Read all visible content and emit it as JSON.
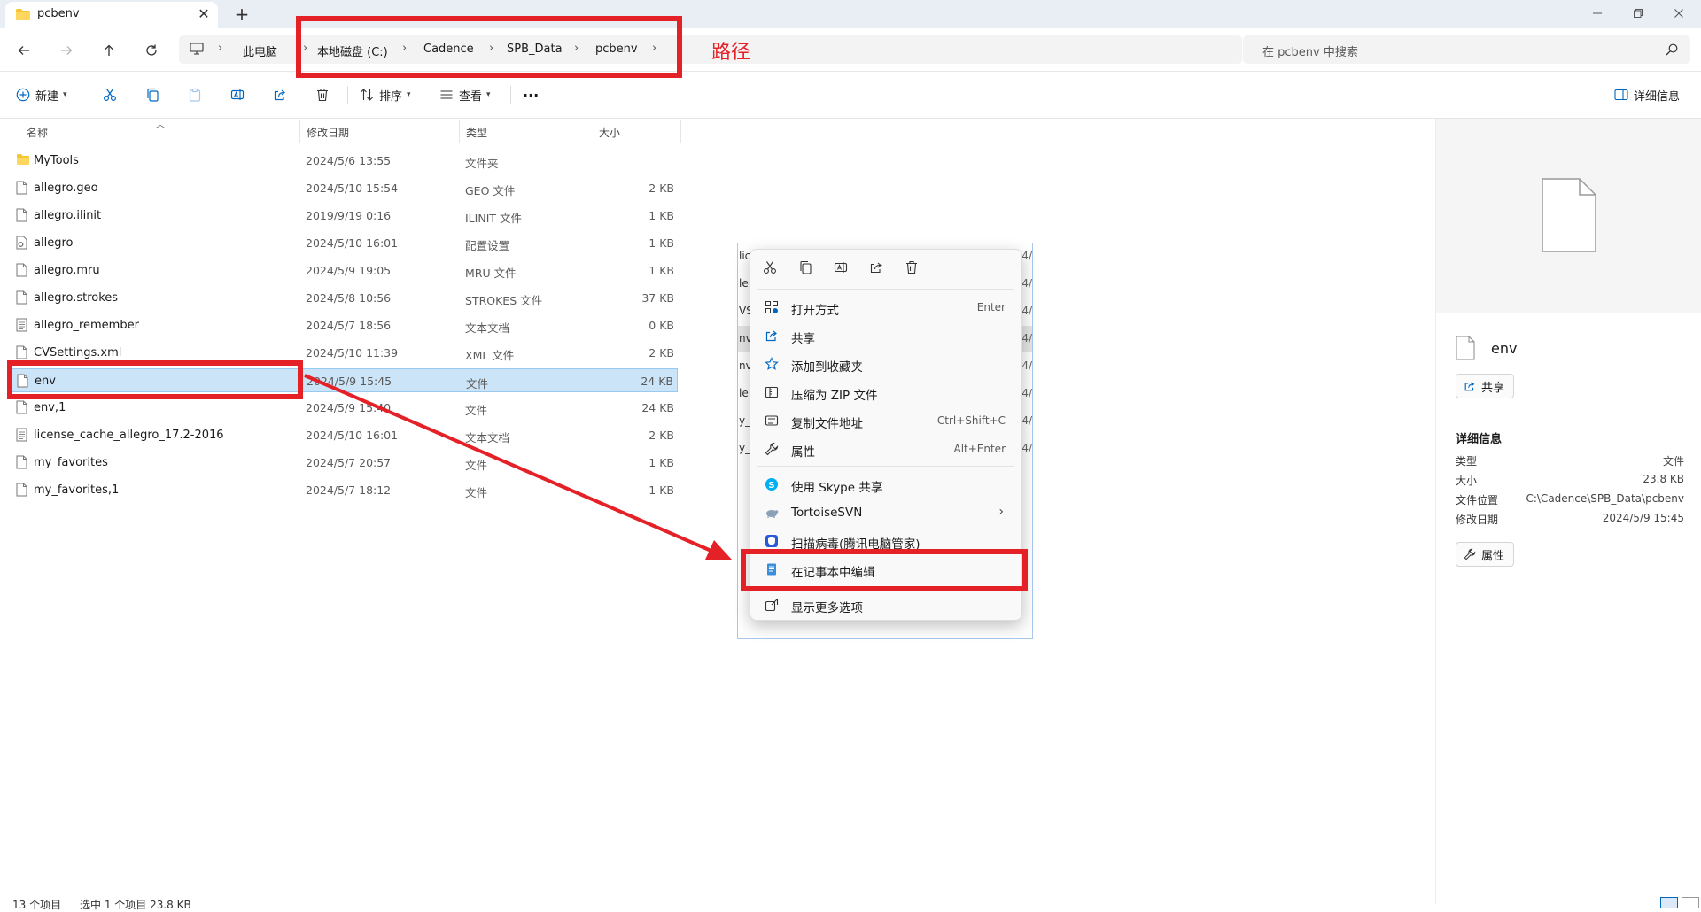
{
  "window": {
    "tab_title": "pcbenv",
    "new_tab_symbol": "+"
  },
  "address": {
    "crumbs": [
      "此电脑",
      "本地磁盘 (C:)",
      "Cadence",
      "SPB_Data",
      "pcbenv"
    ],
    "search_placeholder": "在 pcbenv 中搜索"
  },
  "toolbar": {
    "new_label": "新建",
    "sort_label": "排序",
    "view_label": "查看",
    "more_label": "···",
    "details_label": "详细信息"
  },
  "list": {
    "columns": [
      "名称",
      "修改日期",
      "类型",
      "大小"
    ],
    "rows": [
      {
        "name": "MyTools",
        "date": "2024/5/6 13:55",
        "type": "文件夹",
        "size": "",
        "icon": "folder-icon"
      },
      {
        "name": "allegro.geo",
        "date": "2024/5/10 15:54",
        "type": "GEO 文件",
        "size": "2 KB",
        "icon": "file-icon"
      },
      {
        "name": "allegro.ilinit",
        "date": "2019/9/19 0:16",
        "type": "ILINIT 文件",
        "size": "1 KB",
        "icon": "file-icon"
      },
      {
        "name": "allegro",
        "date": "2024/5/10 16:01",
        "type": "配置设置",
        "size": "1 KB",
        "icon": "config-file-icon"
      },
      {
        "name": "allegro.mru",
        "date": "2024/5/9 19:05",
        "type": "MRU 文件",
        "size": "1 KB",
        "icon": "file-icon"
      },
      {
        "name": "allegro.strokes",
        "date": "2024/5/8 10:56",
        "type": "STROKES 文件",
        "size": "37 KB",
        "icon": "file-icon"
      },
      {
        "name": "allegro_remember",
        "date": "2024/5/7 18:56",
        "type": "文本文档",
        "size": "0 KB",
        "icon": "text-file-icon"
      },
      {
        "name": "CVSettings.xml",
        "date": "2024/5/10 11:39",
        "type": "XML 文件",
        "size": "2 KB",
        "icon": "file-icon"
      },
      {
        "name": "env",
        "date": "2024/5/9 15:45",
        "type": "文件",
        "size": "24 KB",
        "icon": "file-icon"
      },
      {
        "name": "env,1",
        "date": "2024/5/9 15:40",
        "type": "文件",
        "size": "24 KB",
        "icon": "file-icon"
      },
      {
        "name": "license_cache_allegro_17.2-2016",
        "date": "2024/5/10 16:01",
        "type": "文本文档",
        "size": "2 KB",
        "icon": "text-file-icon"
      },
      {
        "name": "my_favorites",
        "date": "2024/5/7 20:57",
        "type": "文件",
        "size": "1 KB",
        "icon": "file-icon"
      },
      {
        "name": "my_favorites,1",
        "date": "2024/5/7 18:12",
        "type": "文件",
        "size": "1 KB",
        "icon": "file-icon"
      }
    ]
  },
  "bg_window": {
    "rows": [
      {
        "left": "lic",
        "right": "2024/"
      },
      {
        "left": "le",
        "right": "4/"
      },
      {
        "left": "VS",
        "right": "4/"
      },
      {
        "left": "nv",
        "right": "4/"
      },
      {
        "left": "nv,",
        "right": "4/"
      },
      {
        "left": "le",
        "right": "4/"
      },
      {
        "left": "y_",
        "right": "4/"
      },
      {
        "left": "y_",
        "right": "4/"
      }
    ]
  },
  "context_menu": {
    "items": [
      {
        "label": "打开方式",
        "shortcut": "Enter",
        "icon": "open-with-icon"
      },
      {
        "label": "共享",
        "shortcut": "",
        "icon": "share-icon"
      },
      {
        "label": "添加到收藏夹",
        "shortcut": "",
        "icon": "star-icon"
      },
      {
        "label": "压缩为 ZIP 文件",
        "shortcut": "",
        "icon": "zip-icon"
      },
      {
        "label": "复制文件地址",
        "shortcut": "Ctrl+Shift+C",
        "icon": "copy-path-icon"
      },
      {
        "label": "属性",
        "shortcut": "Alt+Enter",
        "icon": "wrench-icon"
      },
      {
        "label": "使用 Skype 共享",
        "shortcut": "",
        "icon": "skype-icon"
      },
      {
        "label": "TortoiseSVN",
        "shortcut": "",
        "icon": "tortoisesvn-icon"
      },
      {
        "label": "扫描病毒(腾讯电脑管家)",
        "shortcut": "",
        "icon": "shield-scan-icon"
      },
      {
        "label": "在记事本中编辑",
        "shortcut": "",
        "icon": "notepad-icon"
      },
      {
        "label": "显示更多选项",
        "shortcut": "",
        "icon": "more-options-icon"
      }
    ]
  },
  "details": {
    "file_name": "env",
    "share_label": "共享",
    "section_title": "详细信息",
    "props": [
      {
        "k": "类型",
        "v": "文件"
      },
      {
        "k": "大小",
        "v": "23.8 KB"
      },
      {
        "k": "文件位置",
        "v": "C:\\Cadence\\SPB_Data\\pcbenv"
      },
      {
        "k": "修改日期",
        "v": "2024/5/9 15:45"
      }
    ],
    "properties_label": "属性"
  },
  "status": {
    "count": "13 个项目",
    "selection": "选中 1 个项目 23.8 KB"
  },
  "annotation": {
    "path_label": "路径",
    "color": "#e52128"
  },
  "colors": {
    "selection_bg": "#cce4f7",
    "accent": "#0067c0"
  }
}
